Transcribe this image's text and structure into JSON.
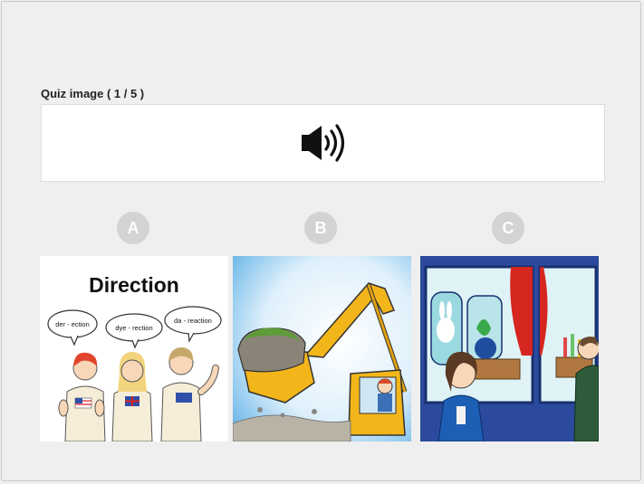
{
  "quiz": {
    "label": "Quiz image ( 1 / 5 )",
    "audio_icon": "speaker-icon"
  },
  "options": [
    {
      "letter": "A",
      "title": "Direction",
      "bubbles": [
        "der - ection",
        "dye - rection",
        "da - reaction"
      ],
      "flags": [
        "us-flag",
        "uk-flag",
        "australia-flag"
      ]
    },
    {
      "letter": "B",
      "scene": "excavator-lifting-rock"
    },
    {
      "letter": "C",
      "scene": "girl-looking-at-science-display-window"
    }
  ],
  "colors": {
    "background": "#efefef",
    "badge": "#d3d3d3",
    "excavator": "#f2b61a"
  }
}
